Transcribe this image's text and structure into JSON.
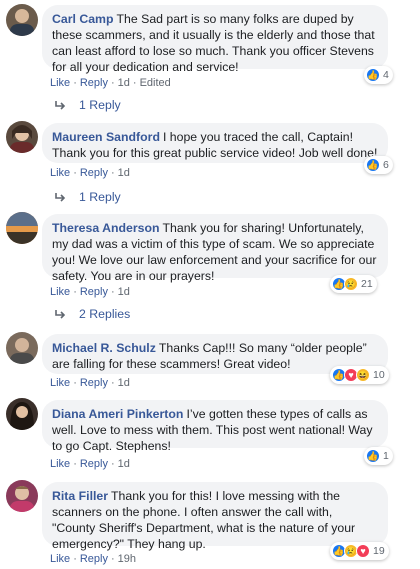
{
  "comments": [
    {
      "author": "Carl Camp",
      "text": "The Sad part is so many folks are duped by these scammers, and it usually is the elderly and those that can least afford to lose so much. Thank you officer Stevens for all your dedication and service!",
      "like": "Like",
      "reply": "Reply",
      "time": "1d",
      "edited": "Edited",
      "reaction_count": "4",
      "replies_label": "1 Reply",
      "colors": {
        "avatar": "#6b5b4b"
      }
    },
    {
      "author": "Maureen Sandford",
      "text": "I hope you traced the call, Captain! Thank you for this great public service video! Job well done!",
      "like": "Like",
      "reply": "Reply",
      "time": "1d",
      "reaction_count": "6",
      "replies_label": "1 Reply",
      "colors": {
        "avatar": "#5a4a3e"
      }
    },
    {
      "author": "Theresa Anderson",
      "text": "Thank you for sharing! Unfortunately, my dad was a victim of this type of scam. We so appreciate you! We love our law enforcement and your sacrifice for our safety. You are in our prayers!",
      "like": "Like",
      "reply": "Reply",
      "time": "1d",
      "reaction_count": "21",
      "replies_label": "2 Replies",
      "colors": {
        "avatar": "#c7793a"
      }
    },
    {
      "author": "Michael R. Schulz",
      "text": "Thanks Cap!!! So many “older people” are falling for these scammers! Great video!",
      "like": "Like",
      "reply": "Reply",
      "time": "1d",
      "reaction_count": "10",
      "colors": {
        "avatar": "#7a6a5c"
      }
    },
    {
      "author": "Diana Ameri Pinkerton",
      "text": "I’ve gotten these types of calls as well. Love to mess with them. This post went national! Way to go Capt. Stephens!",
      "like": "Like",
      "reply": "Reply",
      "time": "1d",
      "reaction_count": "1",
      "colors": {
        "avatar": "#3a2f2a"
      }
    },
    {
      "author": "Rita Filler",
      "text": "Thank you for this! I love messing with the scanners on the phone. I often answer the call with, \"County Sheriff's Department, what is the nature of your emergency?\" They hang up.",
      "like": "Like",
      "reply": "Reply",
      "time": "19h",
      "reaction_count": "19",
      "colors": {
        "avatar": "#8a3a5a"
      }
    }
  ],
  "reaction_icons": {
    "c1": [
      "like"
    ],
    "c2": [
      "like"
    ],
    "c3": [
      "like",
      "sad"
    ],
    "c4": [
      "like",
      "love",
      "haha"
    ],
    "c5": [
      "like"
    ],
    "c6": [
      "like",
      "sad",
      "love"
    ]
  },
  "colors": {
    "link": "#385898",
    "bubble": "#f2f3f5",
    "meta": "#606770",
    "like_blue": "#1877f2"
  }
}
